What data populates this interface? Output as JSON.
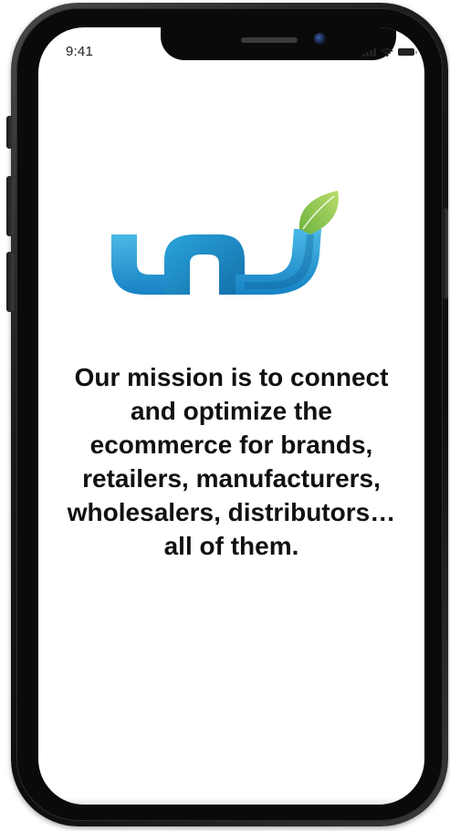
{
  "status_bar": {
    "time": "9:41",
    "icons": [
      "signal-icon",
      "wifi-icon",
      "battery-icon"
    ]
  },
  "logo": {
    "icon": "un-leaf-logo",
    "colors": {
      "primary": "#1e9ad6",
      "light": "#5bc4ea",
      "dark": "#136fa9",
      "leaf": "#8cc63f"
    }
  },
  "mission": {
    "text": "Our mission is to connect and optimize the ecommerce for brands, retailers, manufacturers, wholesalers, distributors…all of them."
  }
}
